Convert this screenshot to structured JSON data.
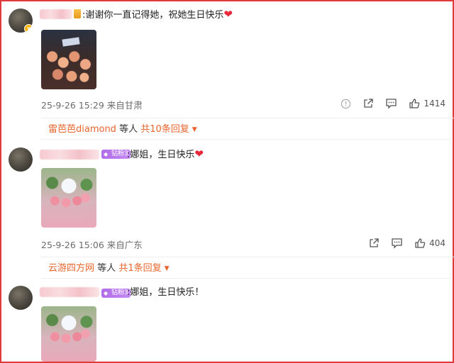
{
  "comments": [
    {
      "text": ":谢谢你一直记得她，祝她生日快乐",
      "heart": "❤",
      "meta": "25-9-26 15:29 来自甘肃",
      "likes": "1414",
      "replies": {
        "user": "雷芭芭diamond",
        "middle": "等人",
        "count": "共10条回复"
      }
    },
    {
      "badge": "钻粉3",
      "text": ":娜姐，生日快乐",
      "heart": "❤",
      "meta": "25-9-26 15:06 来自广东",
      "likes": "404",
      "replies": {
        "user": "云游四方网",
        "middle": "等人",
        "count": "共1条回复"
      }
    },
    {
      "badge": "钻粉3",
      "text": ":娜姐，生日快乐！"
    }
  ],
  "colors": {
    "accent": "#e8642c",
    "border": "#e23a3a",
    "fan_badge": "#b06ce8",
    "heart": "#e8283a"
  },
  "icons": [
    "report-icon",
    "share-icon",
    "comment-icon",
    "like-icon",
    "caret-down-icon",
    "diamond-icon"
  ]
}
